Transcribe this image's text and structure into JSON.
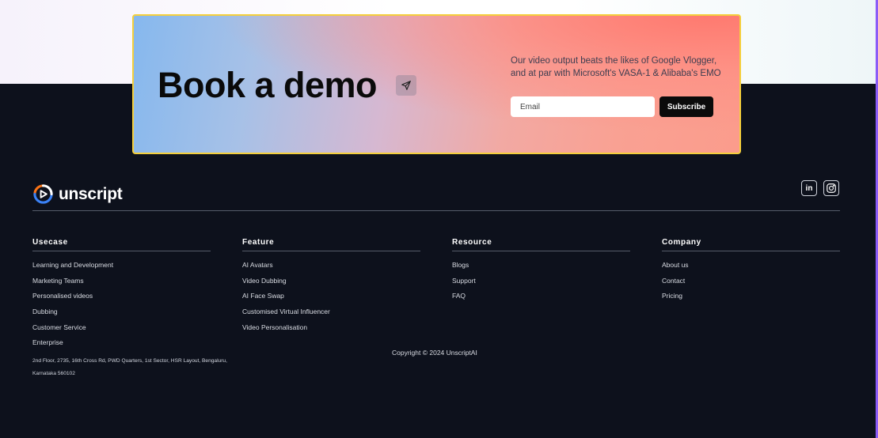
{
  "demo": {
    "title": "Book a demo",
    "description": "Our video output beats the likes of Google Vlogger, and at par with Microsoft's VASA-1 & Alibaba's EMO",
    "email_placeholder": "Email",
    "subscribe_label": "Subscribe"
  },
  "footer": {
    "brand": "unscript",
    "social": {
      "linkedin": "in"
    },
    "columns": [
      {
        "title": "Usecase",
        "items": [
          "Learning and Development",
          "Marketing Teams",
          "Personalised videos",
          "Dubbing",
          "Customer Service",
          "Enterprise"
        ]
      },
      {
        "title": "Feature",
        "items": [
          "AI Avatars",
          "Video Dubbing",
          "AI Face Swap",
          "Customised Virtual Influencer",
          "Video Personalisation"
        ]
      },
      {
        "title": "Resource",
        "items": [
          "Blogs",
          "Support",
          "FAQ"
        ]
      },
      {
        "title": "Company",
        "items": [
          "About us",
          "Contact",
          "Pricing"
        ]
      }
    ],
    "address": "2nd Floor, 2735, 16th Cross Rd, PWD Quarters, 1st Sector, HSR Layout, Bengaluru, Karnataka 560102",
    "copyright": "Copyright © 2024 UnscriptAI"
  },
  "colors": {
    "background": "#0d111c",
    "card_border": "#f4cf3c",
    "accent_logo_orange": "#f97316",
    "accent_logo_blue": "#3b82f6",
    "scroll_edge": "#8b5cf6"
  },
  "icons": [
    "send-icon",
    "unscript-logo-icon",
    "linkedin-icon",
    "instagram-icon"
  ]
}
